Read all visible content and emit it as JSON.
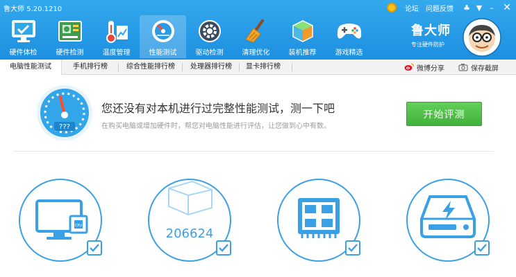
{
  "app": {
    "title": "鲁大师 5.20.1210",
    "links": [
      "论坛",
      "问题反馈"
    ],
    "brand_name": "鲁大师",
    "brand_slogan": "专注硬件防护"
  },
  "nav": [
    {
      "label": "硬件体检",
      "icon": "monitor-check-icon"
    },
    {
      "label": "硬件检测",
      "icon": "motherboard-icon"
    },
    {
      "label": "温度管理",
      "icon": "thermometer-icon"
    },
    {
      "label": "性能测试",
      "icon": "speedometer-icon",
      "active": true
    },
    {
      "label": "驱动检测",
      "icon": "gear-icon"
    },
    {
      "label": "清理优化",
      "icon": "broom-icon"
    },
    {
      "label": "装机推荐",
      "icon": "cube-icon"
    },
    {
      "label": "游戏精选",
      "icon": "gamepad-icon"
    }
  ],
  "tabs": {
    "items": [
      "电脑性能测试",
      "手机排行榜",
      "综合性能排行榜",
      "处理器排行榜",
      "显卡排行榜"
    ],
    "active": 0,
    "weibo_share": "微博分享",
    "save_screenshot": "保存截屏"
  },
  "banner": {
    "headline": "您还没有对本机进行过完整性能测试，测一下吧",
    "subtext": "在购买电脑或增加硬件时，帮您对电脑性能进行评估，让您做到心中有数。",
    "gauge_text": "???",
    "start_button": "开始评测"
  },
  "cards": [
    {
      "icon": "monitor-cpu-icon",
      "checked": true
    },
    {
      "icon": "wireframe-cube-icon",
      "value": "206624",
      "checked": true
    },
    {
      "icon": "memory-chip-icon",
      "checked": true
    },
    {
      "icon": "storage-drive-icon",
      "checked": true
    }
  ],
  "colors": {
    "header": "#1d8fe0",
    "accent": "#3aa0e6",
    "start_button": "#42b13b"
  }
}
